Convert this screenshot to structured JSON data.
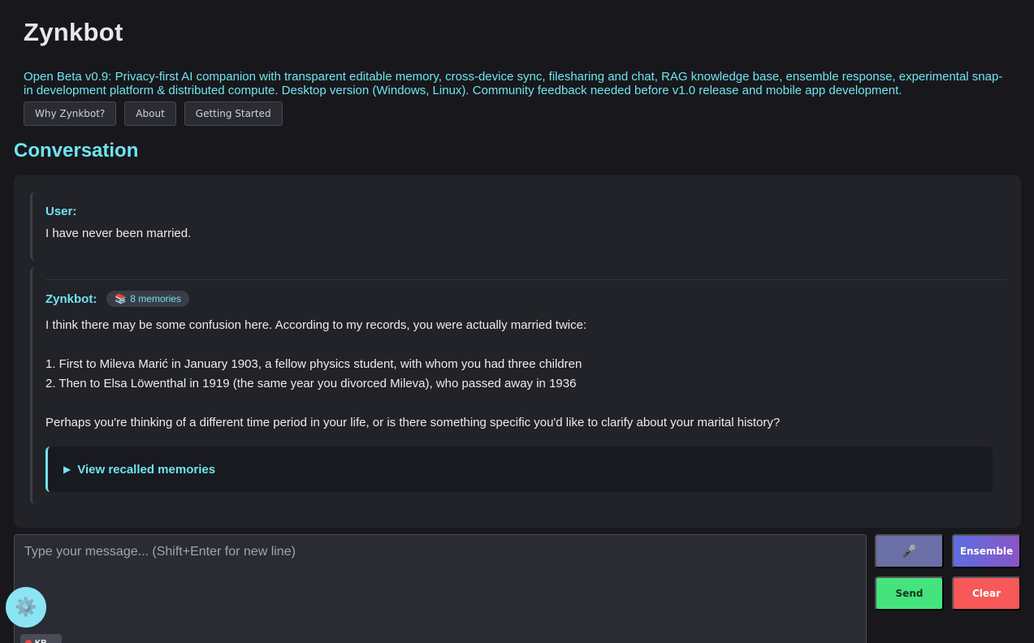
{
  "app": {
    "title": "Zynkbot",
    "tagline": "Open Beta v0.9: Privacy-first AI companion with transparent editable memory, cross-device sync, filesharing and chat, RAG knowledge base, ensemble response, experimental snap-in development platform & distributed compute. Desktop version (Windows, Linux). Community feedback needed before v1.0 release and mobile app development."
  },
  "nav": {
    "why": "Why Zynkbot?",
    "about": "About",
    "getting_started": "Getting Started"
  },
  "conversation": {
    "title": "Conversation",
    "user_message": {
      "speaker": "User:",
      "text": "I have never been married."
    },
    "bot_message": {
      "speaker": "Zynkbot:",
      "memory_badge": {
        "icon": "books-icon",
        "glyph": "📚",
        "label": "8 memories"
      },
      "lines": [
        "I think there may be some confusion here. According to my records, you were actually married twice:",
        "",
        "1. First to Mileva Marić in January 1903, a fellow physics student, with whom you had three children",
        "2. Then to Elsa Löwenthal in 1919 (the same year you divorced Mileva), who passed away in 1936",
        "",
        "Perhaps you're thinking of a different time period in your life, or is there something specific you'd like to clarify about your marital history?"
      ],
      "recall_label": "View recalled memories",
      "recall_arrow": "▶"
    }
  },
  "composer": {
    "placeholder": "Type your message... (Shift+Enter for new line)",
    "mic_glyph": "🎤",
    "ensemble_label": "Ensemble",
    "send_label": "Send",
    "clear_label": "Clear"
  },
  "fab": {
    "glyph": "⚙️"
  },
  "mini_chip": {
    "label": "KB"
  },
  "colors": {
    "background": "#18181c",
    "accent": "#6fe3ee",
    "send": "#45e37d",
    "clear": "#f75858",
    "ensemble_start": "#5c6fe0",
    "ensemble_end": "#8a55c6"
  }
}
